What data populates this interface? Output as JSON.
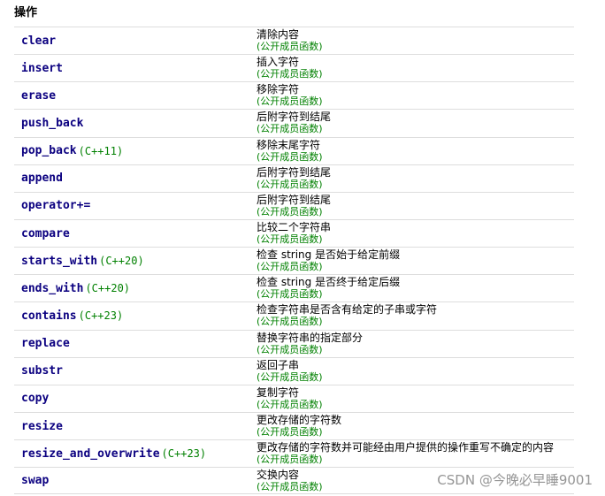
{
  "section": {
    "heading": "操作"
  },
  "members": [
    {
      "name": "clear",
      "version": "",
      "desc": "清除内容",
      "kind": "(公开成员函数)"
    },
    {
      "name": "insert",
      "version": "",
      "desc": "插入字符",
      "kind": "(公开成员函数)"
    },
    {
      "name": "erase",
      "version": "",
      "desc": "移除字符",
      "kind": "(公开成员函数)"
    },
    {
      "name": "push_back",
      "version": "",
      "desc": "后附字符到结尾",
      "kind": "(公开成员函数)"
    },
    {
      "name": "pop_back",
      "version": "(C++11)",
      "desc": "移除末尾字符",
      "kind": "(公开成员函数)"
    },
    {
      "name": "append",
      "version": "",
      "desc": "后附字符到结尾",
      "kind": "(公开成员函数)"
    },
    {
      "name": "operator+=",
      "version": "",
      "desc": "后附字符到结尾",
      "kind": "(公开成员函数)"
    },
    {
      "name": "compare",
      "version": "",
      "desc": "比较二个字符串",
      "kind": "(公开成员函数)"
    },
    {
      "name": "starts_with",
      "version": "(C++20)",
      "desc": "检查 string 是否始于给定前缀",
      "kind": "(公开成员函数)"
    },
    {
      "name": "ends_with",
      "version": "(C++20)",
      "desc": "检查 string 是否终于给定后缀",
      "kind": "(公开成员函数)"
    },
    {
      "name": "contains",
      "version": "(C++23)",
      "desc": "检查字符串是否含有给定的子串或字符",
      "kind": "(公开成员函数)"
    },
    {
      "name": "replace",
      "version": "",
      "desc": "替换字符串的指定部分",
      "kind": "(公开成员函数)"
    },
    {
      "name": "substr",
      "version": "",
      "desc": "返回子串",
      "kind": "(公开成员函数)"
    },
    {
      "name": "copy",
      "version": "",
      "desc": "复制字符",
      "kind": "(公开成员函数)"
    },
    {
      "name": "resize",
      "version": "",
      "desc": "更改存储的字符数",
      "kind": "(公开成员函数)"
    },
    {
      "name": "resize_and_overwrite",
      "version": "(C++23)",
      "desc": "更改存储的字符数并可能经由用户提供的操作重写不确定的内容",
      "kind": "(公开成员函数)"
    },
    {
      "name": "swap",
      "version": "",
      "desc": "交换内容",
      "kind": "(公开成员函数)"
    }
  ],
  "watermark": "CSDN @今晚必早睡9001",
  "colors": {
    "link": "#0b0080",
    "version": "#008000",
    "kind": "#008000",
    "divider": "#dddddd",
    "watermark": "#8a8a8a"
  }
}
